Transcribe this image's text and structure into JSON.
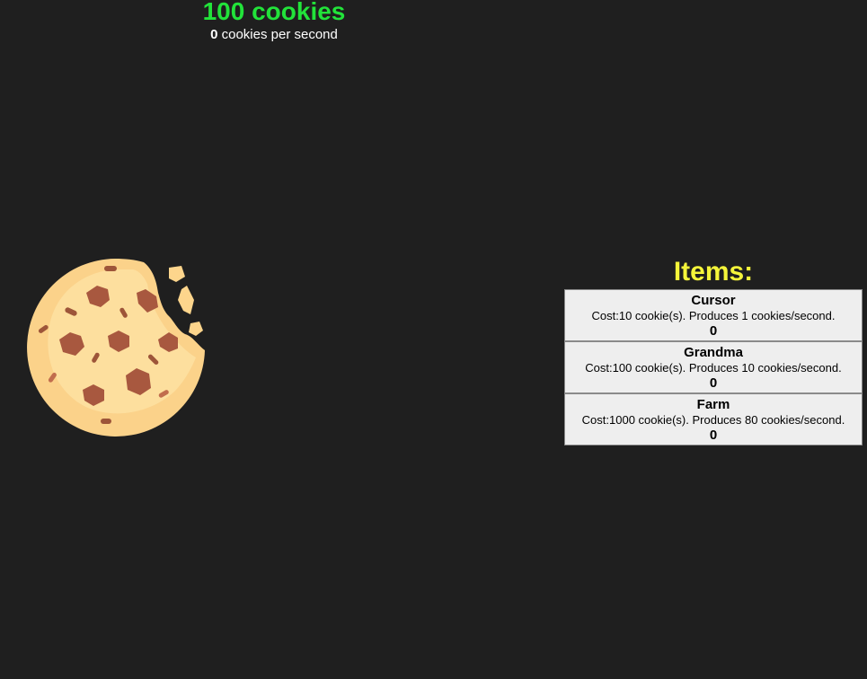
{
  "stats": {
    "cookies_text": "100 cookies",
    "cps_value": "0",
    "cps_label": " cookies per second"
  },
  "cookie": {
    "icon": "cookie-icon",
    "colors": {
      "dough": "#fbd28a",
      "dough_light": "#fde4a6",
      "chip": "#a8583f",
      "chip_light": "#c16d4d",
      "sprinkle": "#9d5539",
      "crumb": "#fdd58c"
    }
  },
  "items": {
    "title": "Items:",
    "list": [
      {
        "name": "Cursor",
        "desc": "Cost:10 cookie(s). Produces 1 cookies/second.",
        "count": "0"
      },
      {
        "name": "Grandma",
        "desc": "Cost:100 cookie(s). Produces 10 cookies/second.",
        "count": "0"
      },
      {
        "name": "Farm",
        "desc": "Cost:1000 cookie(s). Produces 80 cookies/second.",
        "count": "0"
      }
    ]
  },
  "colors": {
    "background": "#1f1f1f",
    "cookies_text": "#22e33a",
    "items_title": "#f5f53a",
    "item_bg": "#eeeeee"
  }
}
